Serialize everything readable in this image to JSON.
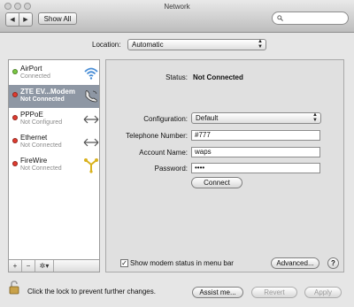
{
  "window": {
    "title": "Network"
  },
  "toolbar": {
    "back_glyph": "◀",
    "forward_glyph": "▶",
    "show_all_label": "Show All",
    "search_placeholder": "",
    "search_icon": "search-icon"
  },
  "location": {
    "label": "Location:",
    "value": "Automatic"
  },
  "services": [
    {
      "name": "AirPort",
      "status": "Connected",
      "status_color": "#7ac943",
      "icon": "wifi-icon",
      "selected": false
    },
    {
      "name": "ZTE EV...Modem",
      "status": "Not Connected",
      "status_color": "#e03b2f",
      "icon": "phone-modem-icon",
      "selected": true
    },
    {
      "name": "PPPoE",
      "status": "Not Configured",
      "status_color": "#e03b2f",
      "icon": "ethernet-arrows-icon",
      "selected": false
    },
    {
      "name": "Ethernet",
      "status": "Not Connected",
      "status_color": "#e03b2f",
      "icon": "ethernet-arrows-icon",
      "selected": false
    },
    {
      "name": "FireWire",
      "status": "Not Connected",
      "status_color": "#e03b2f",
      "icon": "firewire-icon",
      "selected": false
    }
  ],
  "sidebar_tools": {
    "add": "+",
    "remove": "−",
    "action": "✲▾"
  },
  "detail": {
    "status_label": "Status:",
    "status_value": "Not Connected",
    "configuration_label": "Configuration:",
    "configuration_value": "Default",
    "telephone_label": "Telephone Number:",
    "telephone_value": "#777",
    "account_label": "Account Name:",
    "account_value": "waps",
    "password_label": "Password:",
    "password_value": "••••",
    "connect_label": "Connect",
    "show_status_label": "Show modem status in menu bar",
    "show_status_checked": true,
    "checkmark": "✓",
    "advanced_label": "Advanced...",
    "help_label": "?"
  },
  "footer": {
    "lock_text": "Click the lock to prevent further changes.",
    "assist_label": "Assist me...",
    "revert_label": "Revert",
    "apply_label": "Apply"
  }
}
